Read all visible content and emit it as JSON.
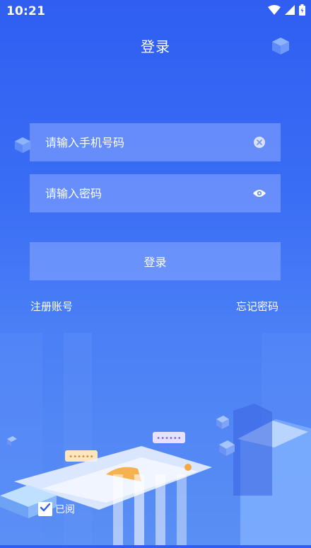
{
  "status_bar": {
    "time": "10:21"
  },
  "page_title": "登录",
  "phone_field": {
    "placeholder": "请输入手机号码",
    "value": ""
  },
  "password_field": {
    "placeholder": "请输入密码",
    "value": ""
  },
  "login_button_label": "登录",
  "register_link": "注册账号",
  "forgot_link": "忘记密码",
  "agreement": {
    "checked": true,
    "label": "已阅"
  },
  "icons": {
    "clear": "clear-circle-icon",
    "visibility": "eye-icon",
    "wifi": "wifi-icon",
    "signal": "signal-icon",
    "battery": "battery-icon"
  },
  "colors": {
    "background_top": "#2f5ef1",
    "background_bottom": "#5a8ff4",
    "field_bg": "#8caaff"
  }
}
